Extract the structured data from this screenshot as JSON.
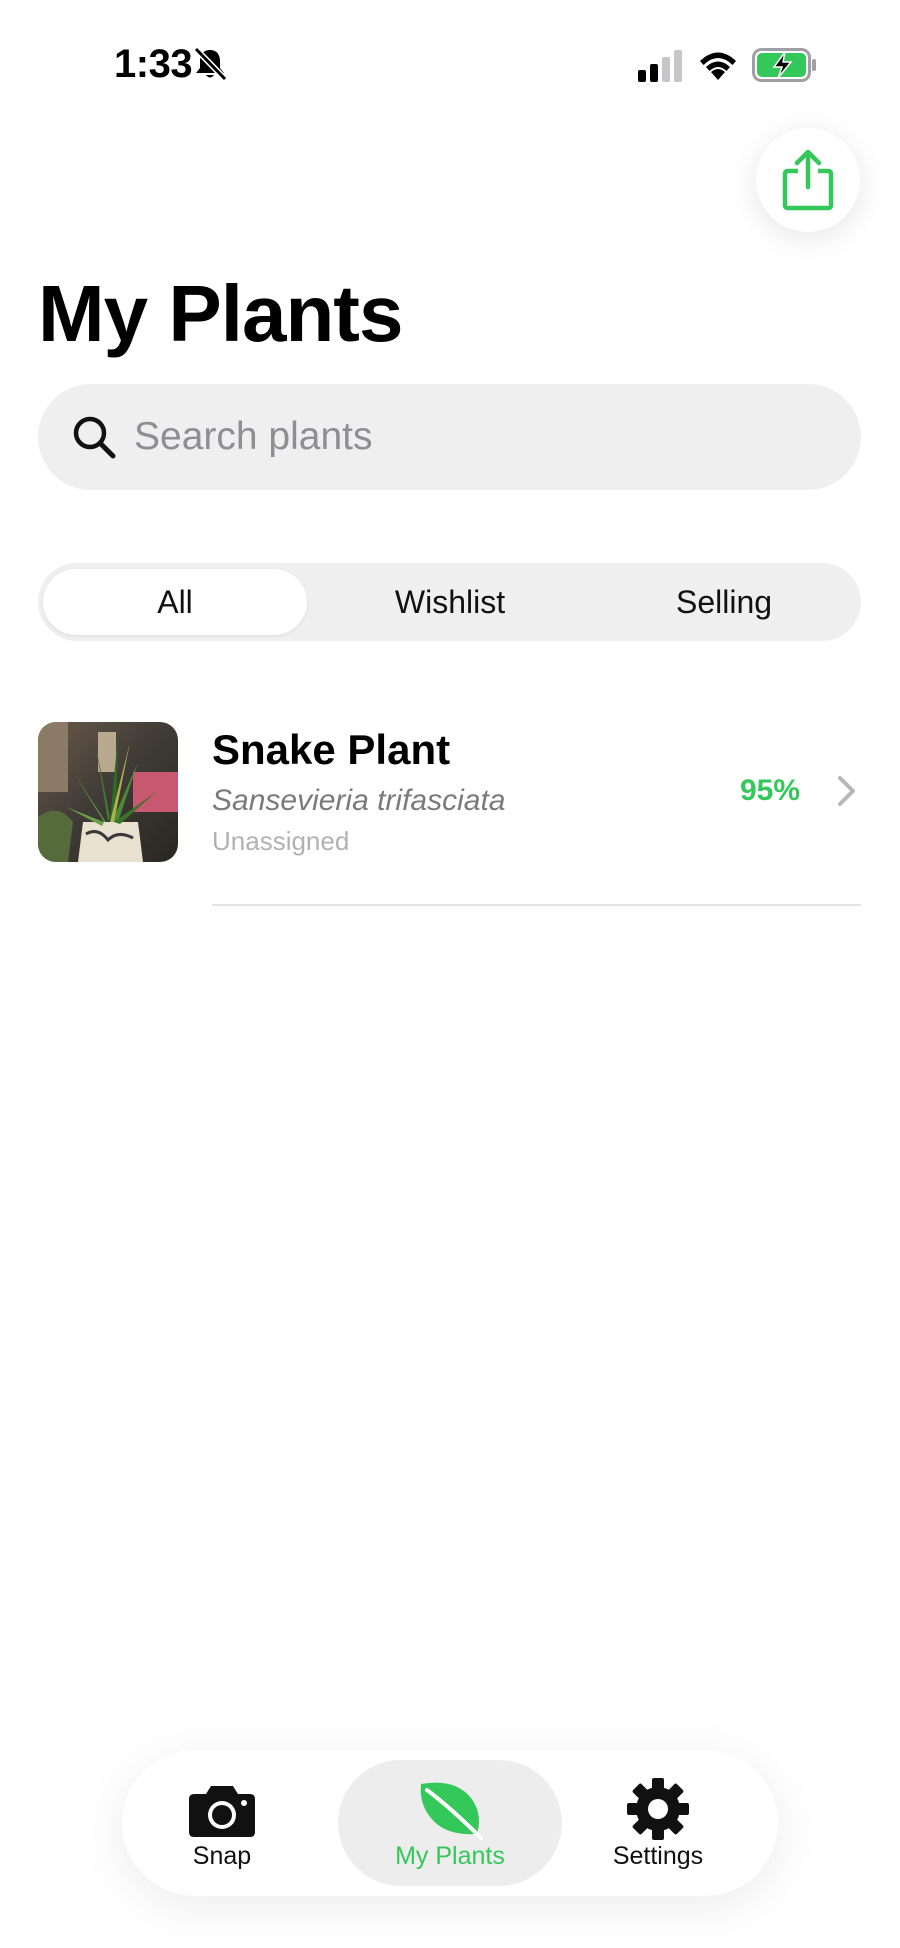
{
  "status_bar": {
    "time": "1:33",
    "icons": [
      "bell-slash-icon",
      "signal-icon",
      "wifi-icon",
      "battery-charging-icon"
    ]
  },
  "header": {
    "title": "My Plants",
    "share_icon": "share-icon"
  },
  "search": {
    "placeholder": "Search plants",
    "value": ""
  },
  "filters": {
    "selected": "All",
    "options": [
      "All",
      "Wishlist",
      "Selling"
    ]
  },
  "plants": [
    {
      "name": "Snake Plant",
      "scientific_name": "Sansevieria trifasciata",
      "group": "Unassigned",
      "score": "95%"
    }
  ],
  "tab_bar": {
    "selected": "My Plants",
    "tabs": [
      {
        "label": "Snap",
        "icon": "camera-icon"
      },
      {
        "label": "My Plants",
        "icon": "leaf-icon"
      },
      {
        "label": "Settings",
        "icon": "gear-icon"
      }
    ]
  },
  "colors": {
    "accent": "#34c759",
    "background": "#ffffff",
    "surface": "#efefef"
  }
}
